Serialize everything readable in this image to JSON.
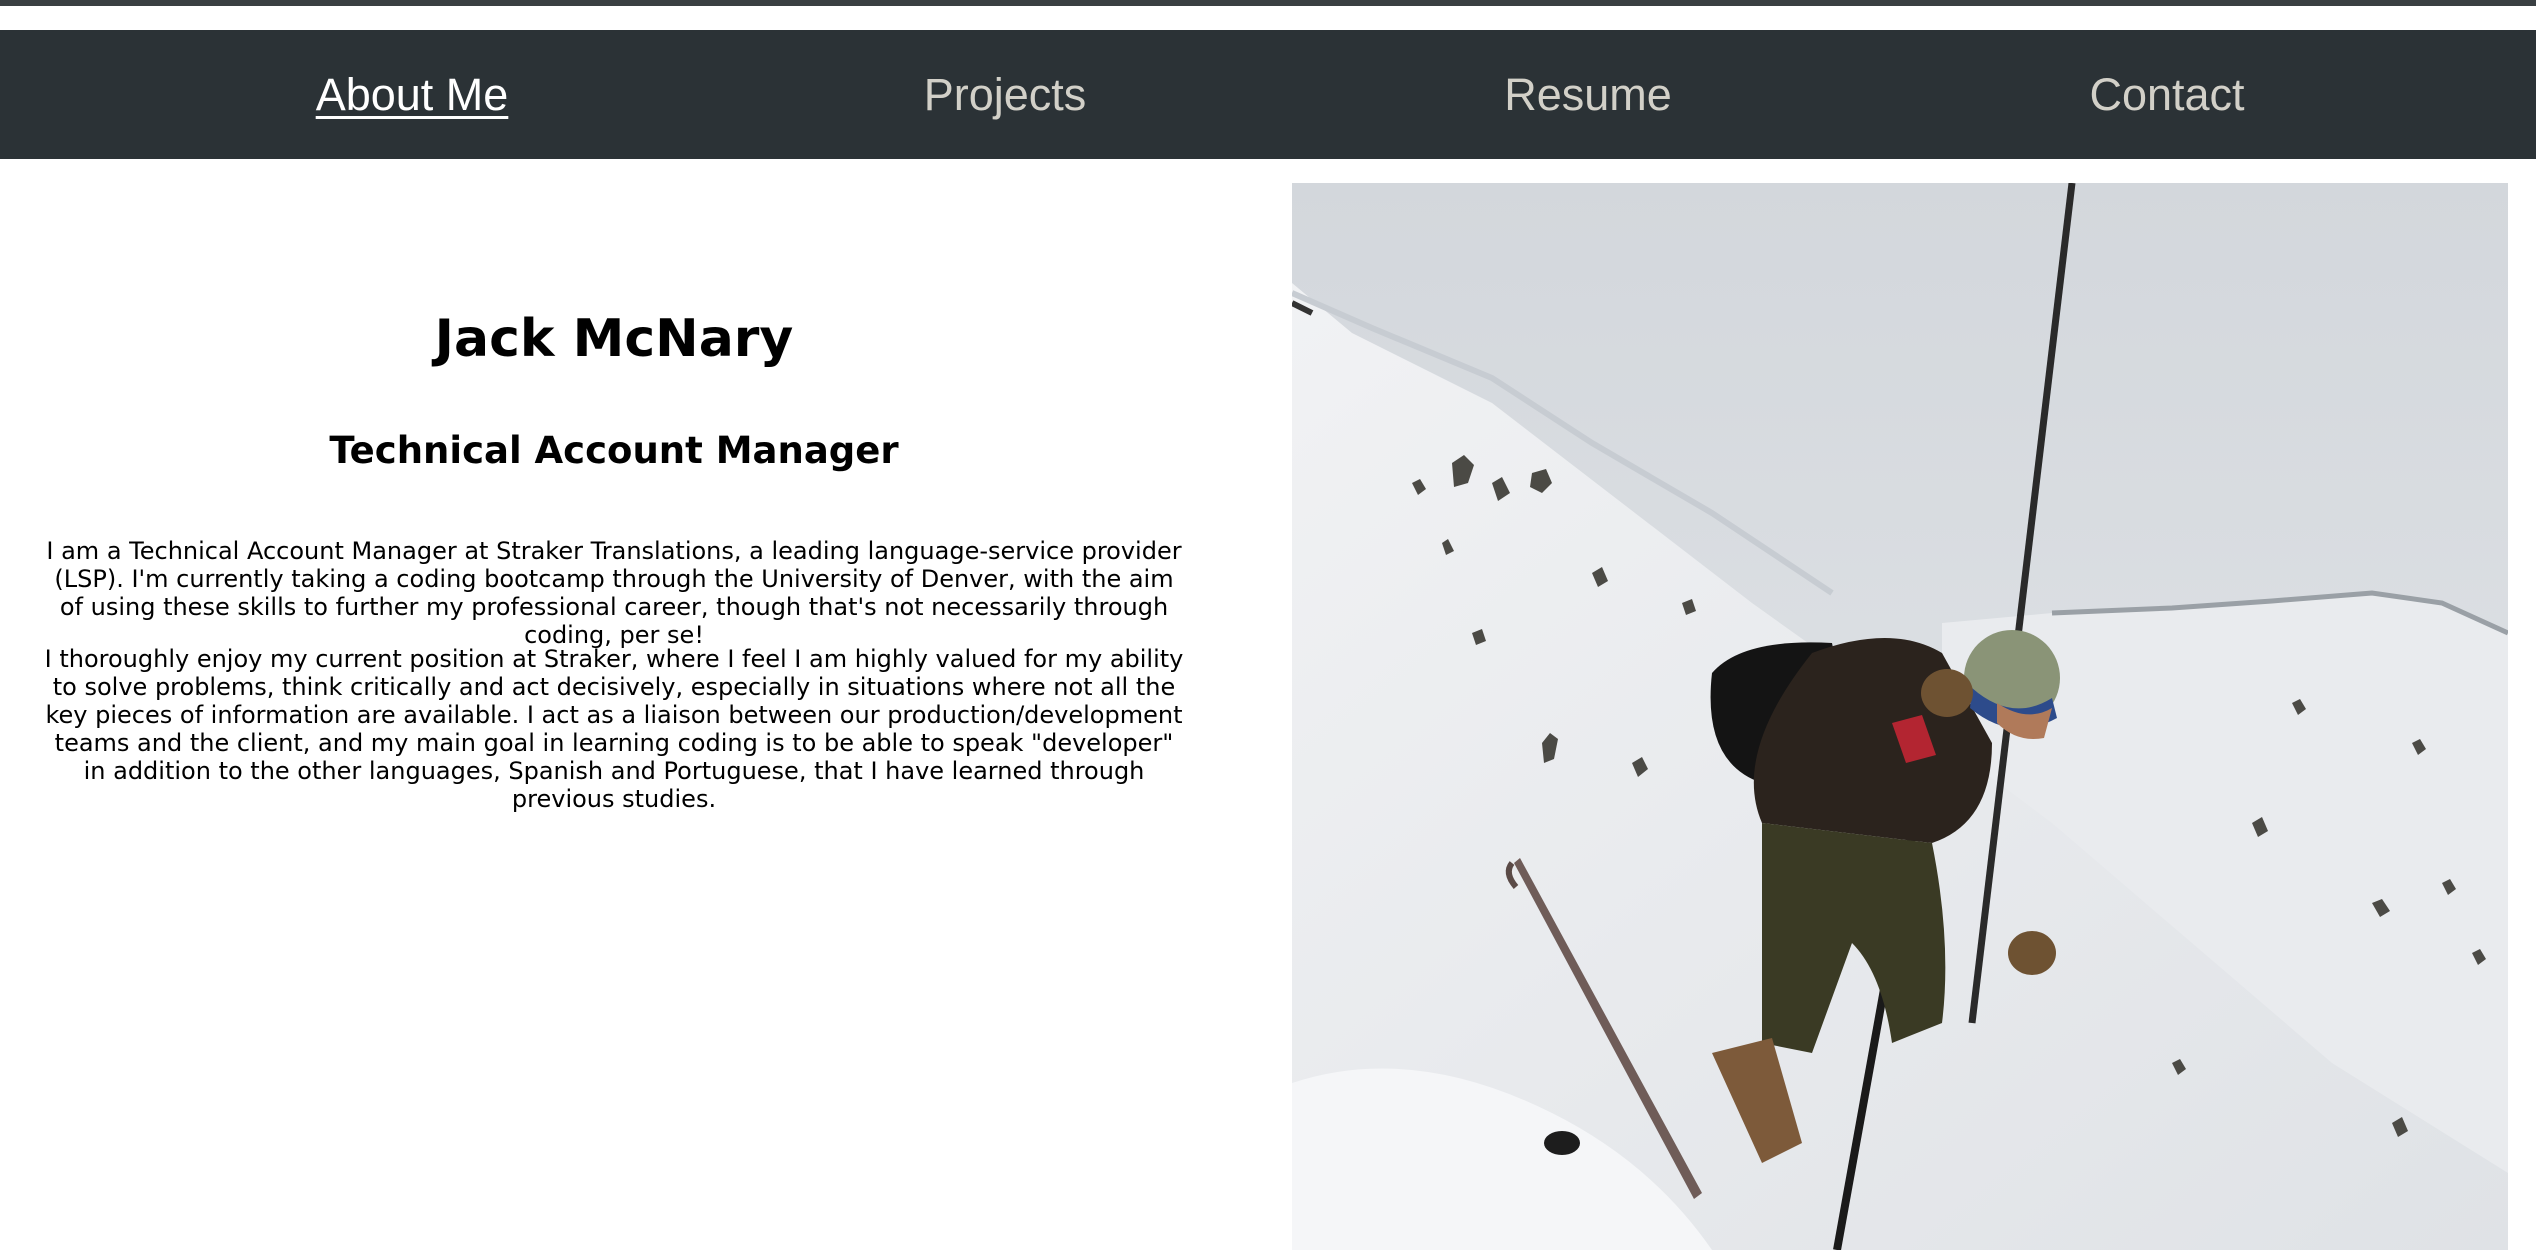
{
  "nav": {
    "items": [
      {
        "label": "About Me",
        "active": true
      },
      {
        "label": "Projects",
        "active": false
      },
      {
        "label": "Resume",
        "active": false
      },
      {
        "label": "Contact",
        "active": false
      }
    ]
  },
  "profile": {
    "name": "Jack McNary",
    "title": "Technical Account Manager",
    "bio_paragraphs": [
      "I am a Technical Account Manager at Straker Translations, a leading language-service provider (LSP). I'm currently taking a coding bootcamp through the University of Denver, with the aim of using these skills to further my professional career, though that's not necessarily through coding, per se!",
      "I thoroughly enjoy my current position at Straker, where I feel I am highly valued for my ability to solve problems, think critically and act decisively, especially in situations where not all the key pieces of information are available. I act as a liaison between our production/development teams and the client, and my main goal in learning coding is to be able to speak \"developer\" in addition to the other languages, Spanish and Portuguese, that I have learned through previous studies."
    ]
  },
  "colors": {
    "navbar_bg": "#2b3236",
    "nav_text": "#d2d0c8",
    "nav_active_text": "#ffffff",
    "page_bg": "#ffffff",
    "body_text": "#000000"
  }
}
